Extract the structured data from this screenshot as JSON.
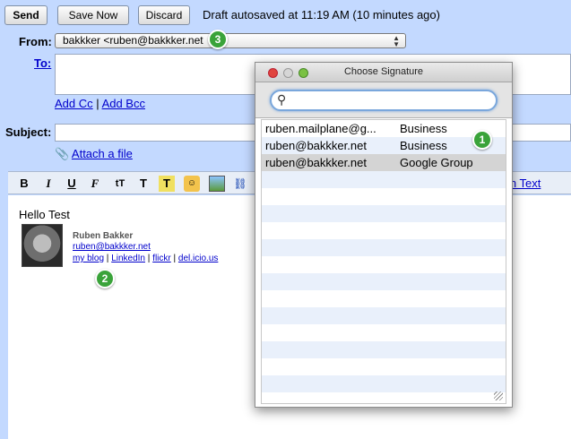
{
  "toolbar": {
    "send_label": "Send",
    "save_now_label": "Save Now",
    "discard_label": "Discard",
    "autosave_text": "Draft autosaved at 11:19 AM (10 minutes ago)"
  },
  "compose": {
    "from_label": "From:",
    "from_value": "bakkker <ruben@bakkker.net",
    "to_label": "To:",
    "add_cc": "Add Cc",
    "separator": "|",
    "add_bcc": "Add Bcc",
    "subject_label": "Subject:",
    "attach_label": "Attach a file",
    "plain_text": "in Text"
  },
  "editor": {
    "body_text": "Hello Test",
    "signature": {
      "name": "Ruben Bakker",
      "email": "ruben@bakkker.net",
      "links": [
        "my blog",
        "LinkedIn",
        "flickr",
        "del.icio.us"
      ]
    }
  },
  "badges": [
    "1",
    "2",
    "3"
  ],
  "dialog": {
    "title": "Choose Signature",
    "search_placeholder": "",
    "rows": [
      {
        "address": "ruben.mailplane@g...",
        "type": "Business"
      },
      {
        "address": "ruben@bakkker.net",
        "type": "Business"
      },
      {
        "address": "ruben@bakkker.net",
        "type": "Google Group"
      }
    ]
  },
  "colors": {
    "background": "#c3d9ff",
    "link": "#0000cc",
    "badge": "#3aa33a"
  }
}
